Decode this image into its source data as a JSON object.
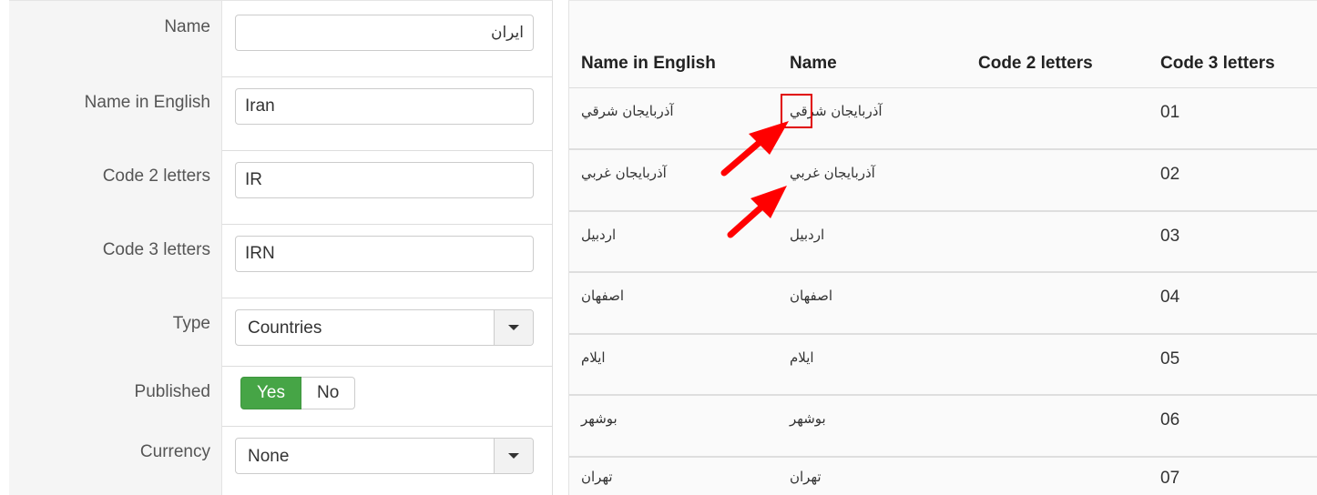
{
  "form": {
    "name": {
      "label": "Name",
      "value": "ایران"
    },
    "name_en": {
      "label": "Name in English",
      "value": "Iran"
    },
    "code2": {
      "label": "Code 2 letters",
      "value": "IR"
    },
    "code3": {
      "label": "Code 3 letters",
      "value": "IRN"
    },
    "type": {
      "label": "Type",
      "value": "Countries"
    },
    "published": {
      "label": "Published",
      "yes": "Yes",
      "no": "No",
      "selected": "Yes"
    },
    "currency": {
      "label": "Currency",
      "value": "None"
    }
  },
  "table": {
    "headers": {
      "name_en": "Name in English",
      "name": "Name",
      "code2": "Code 2 letters",
      "code3": "Code 3 letters"
    },
    "rows": [
      {
        "name_en": "آذربایجان شرقي",
        "name": "آذربایجان شرقي",
        "code2": "",
        "code3": "01"
      },
      {
        "name_en": "آذربایجان غربي",
        "name": "آذربایجان غربي",
        "code2": "",
        "code3": "02"
      },
      {
        "name_en": "اردبيل",
        "name": "اردبيل",
        "code2": "",
        "code3": "03"
      },
      {
        "name_en": "اصفهان",
        "name": "اصفهان",
        "code2": "",
        "code3": "04"
      },
      {
        "name_en": "ايلام",
        "name": "ايلام",
        "code2": "",
        "code3": "05"
      },
      {
        "name_en": "بوشهر",
        "name": "بوشهر",
        "code2": "",
        "code3": "06"
      },
      {
        "name_en": "تهران",
        "name": "تهران",
        "code2": "",
        "code3": "07"
      }
    ]
  },
  "colors": {
    "yes_active": "#46a546",
    "annotation": "#e00000"
  }
}
